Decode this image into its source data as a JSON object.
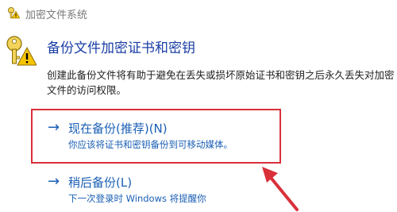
{
  "window": {
    "title": "加密文件系统"
  },
  "content": {
    "heading": "备份文件加密证书和密钥",
    "description": "创建此备份文件将有助于避免在丢失或损坏原始证书和密钥之后永久丢失对加密文件的访问权限。"
  },
  "options": [
    {
      "arrow": "→",
      "title": "现在备份(推荐)(N)",
      "subtitle": "你应该将证书和密钥备份到可移动媒体。"
    },
    {
      "arrow": "→",
      "title": "稍后备份(L)",
      "subtitle": "下一次登录时 Windows 将提醒你"
    }
  ],
  "colors": {
    "accent": "#1a5fb4",
    "heading": "#1a3fa6",
    "annotation": "#d9303a"
  },
  "icons": {
    "title": "key-warning-icon",
    "main": "key-warning-icon",
    "annotation": "red-arrow-icon"
  }
}
